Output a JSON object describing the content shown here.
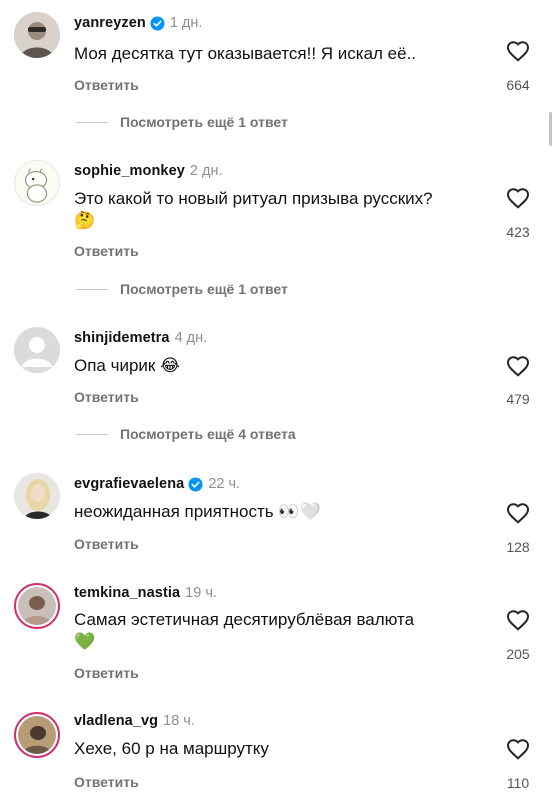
{
  "comments": [
    {
      "username": "yanreyzen",
      "verified": true,
      "time": "1 дн.",
      "text": "Моя десятка тут оказывается!! Я искал её..",
      "reply": "Ответить",
      "likes": "664",
      "more": "Посмотреть ещё 1 ответ",
      "avatar": "photo-person"
    },
    {
      "username": "sophie_monkey",
      "verified": false,
      "time": "2 дн.",
      "text": "Это какой то новый ритуал призыва русских?",
      "emoji": "🤔",
      "reply": "Ответить",
      "likes": "423",
      "more": "Посмотреть ещё 1 ответ",
      "avatar": "moomin"
    },
    {
      "username": "shinjidemetra",
      "verified": false,
      "time": "4 дн.",
      "text": "Опа чирик",
      "emoji": "😂",
      "reply": "Ответить",
      "likes": "479",
      "more": "Посмотреть ещё 4 ответа",
      "avatar": "default-user"
    },
    {
      "username": "evgrafievaelena",
      "verified": true,
      "time": "22 ч.",
      "text": "неожиданная приятность",
      "emoji": "👀🤍",
      "reply": "Ответить",
      "likes": "128",
      "avatar": "photo-blonde"
    },
    {
      "username": "temkina_nastia",
      "verified": false,
      "time": "19 ч.",
      "text": "Самая эстетичная десятирублёвая валюта",
      "emoji": "💚",
      "reply": "Ответить",
      "likes": "205",
      "avatar": "photo-story"
    },
    {
      "username": "vladlena_vg",
      "verified": false,
      "time": "18 ч.",
      "text": "Хехе, 60 р на маршрутку",
      "reply": "Ответить",
      "likes": "110",
      "avatar": "photo-story"
    }
  ],
  "colors": {
    "verified_blue": "#0095f6",
    "story_ring": "#d1306c",
    "muted_text": "#737373"
  }
}
